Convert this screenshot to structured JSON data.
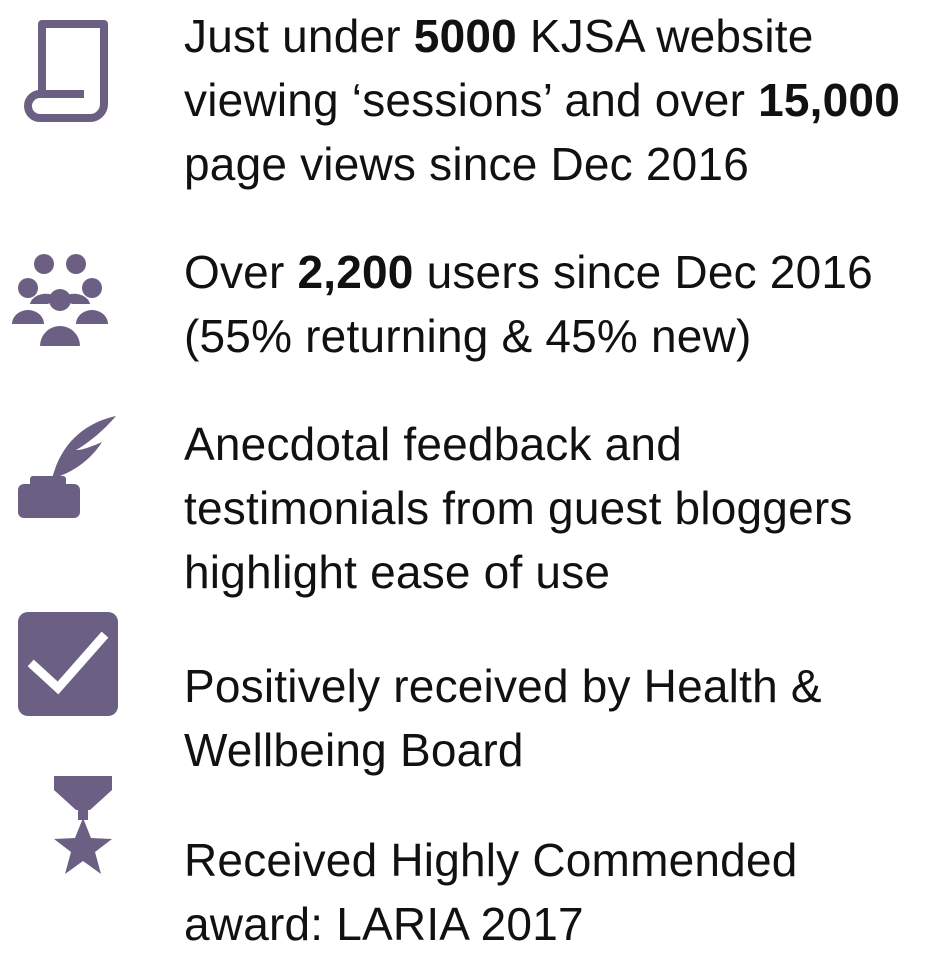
{
  "colors": {
    "icon": "#6b6083",
    "text": "#111111",
    "background": "#ffffff"
  },
  "items": [
    {
      "icon": "scroll-icon",
      "lines": [
        {
          "pre": "Just under ",
          "bold": "5000",
          "post": " KJSA website"
        },
        {
          "pre": "viewing ‘sessions’ and over ",
          "bold": "15,000",
          "post": ""
        },
        {
          "pre": "page views since Dec 2016",
          "bold": "",
          "post": ""
        }
      ]
    },
    {
      "icon": "users-group-icon",
      "lines": [
        {
          "pre": "Over ",
          "bold": "2,200",
          "post": " users since Dec 2016"
        },
        {
          "pre": "(55% returning & 45% new)",
          "bold": "",
          "post": ""
        }
      ]
    },
    {
      "icon": "quill-ink-icon",
      "lines": [
        {
          "pre": "Anecdotal feedback and",
          "bold": "",
          "post": ""
        },
        {
          "pre": "testimonials from guest bloggers",
          "bold": "",
          "post": ""
        },
        {
          "pre": "highlight ease of use",
          "bold": "",
          "post": ""
        }
      ]
    },
    {
      "icon": "checkbox-checked-icon",
      "lines": [
        {
          "pre": "Positively received by Health &",
          "bold": "",
          "post": ""
        },
        {
          "pre": "Wellbeing Board",
          "bold": "",
          "post": ""
        }
      ]
    },
    {
      "icon": "medal-star-icon",
      "lines": [
        {
          "pre": "Received Highly Commended",
          "bold": "",
          "post": ""
        },
        {
          "pre": "award: LARIA 2017",
          "bold": "",
          "post": ""
        }
      ]
    }
  ]
}
